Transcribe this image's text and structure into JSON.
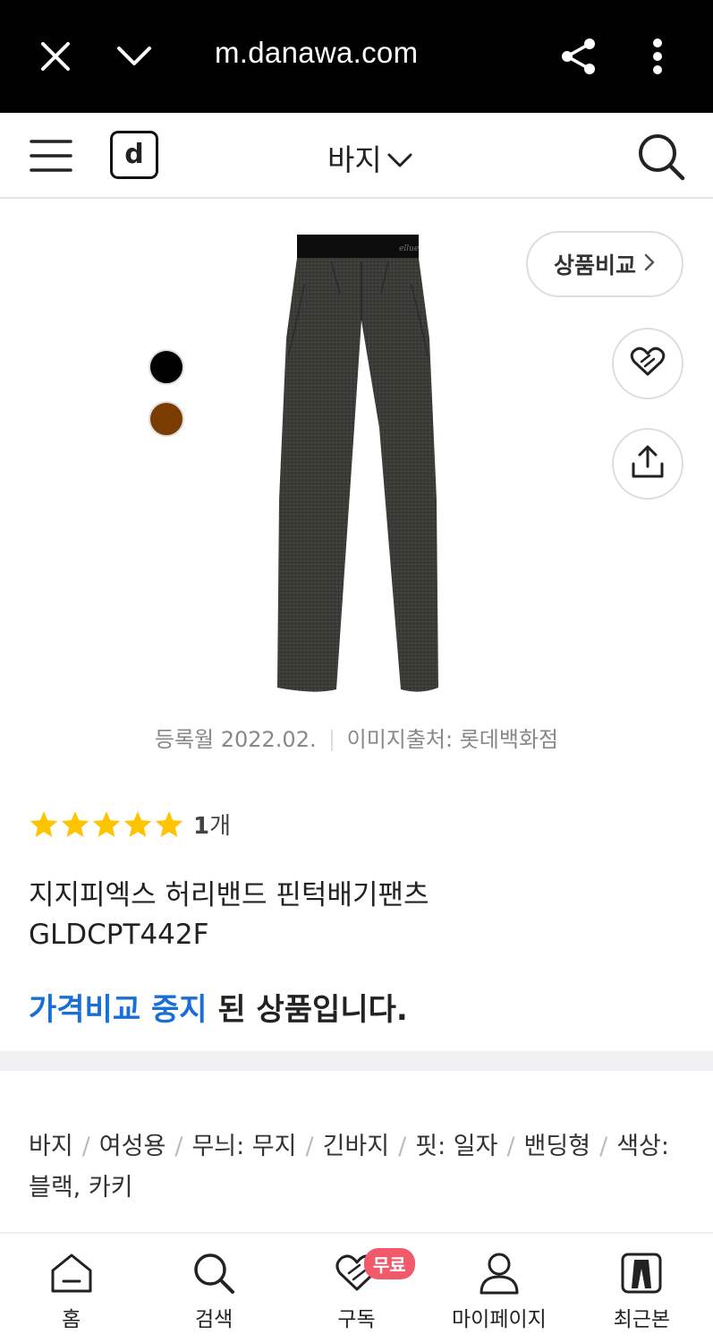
{
  "browser": {
    "url": "m.danawa.com",
    "icons": [
      "close-icon",
      "chevron-down-icon",
      "share-icon",
      "more-vertical-icon"
    ]
  },
  "header": {
    "logo_letter": "d",
    "category": "바지",
    "icons": [
      "hamburger-menu-icon",
      "chevron-down-icon",
      "search-icon"
    ]
  },
  "product": {
    "swatches": [
      {
        "name": "black",
        "color": "#000000"
      },
      {
        "name": "brown",
        "color": "#7a3c00"
      }
    ],
    "compare_label": "상품비교",
    "registered": "등록월 2022.02.",
    "image_source": "이미지출처: 롯데백화점",
    "rating": {
      "stars": 5,
      "count": "1",
      "count_unit": "개"
    },
    "name_line1": "지지피엑스 허리밴드 핀턱배기팬츠",
    "name_line2": "GLDCPT442F",
    "status_highlight": "가격비교 중지",
    "status_rest": " 된 상품입니다.",
    "specs": [
      "바지",
      "여성용",
      "무늬: 무지",
      "긴바지",
      "핏: 일자",
      "밴딩형",
      "색상: 블랙, 카키"
    ]
  },
  "colors": {
    "accent_blue": "#1a6fd6",
    "star_yellow": "#ffc400",
    "badge_pink": "#f05a6b"
  },
  "bottom_nav": {
    "items": [
      {
        "label": "홈",
        "icon": "home-icon"
      },
      {
        "label": "검색",
        "icon": "search-icon"
      },
      {
        "label": "구독",
        "icon": "subscribe-heart-icon",
        "badge": "무료"
      },
      {
        "label": "마이페이지",
        "icon": "user-icon"
      },
      {
        "label": "최근본",
        "icon": "recent-product-icon"
      }
    ]
  }
}
